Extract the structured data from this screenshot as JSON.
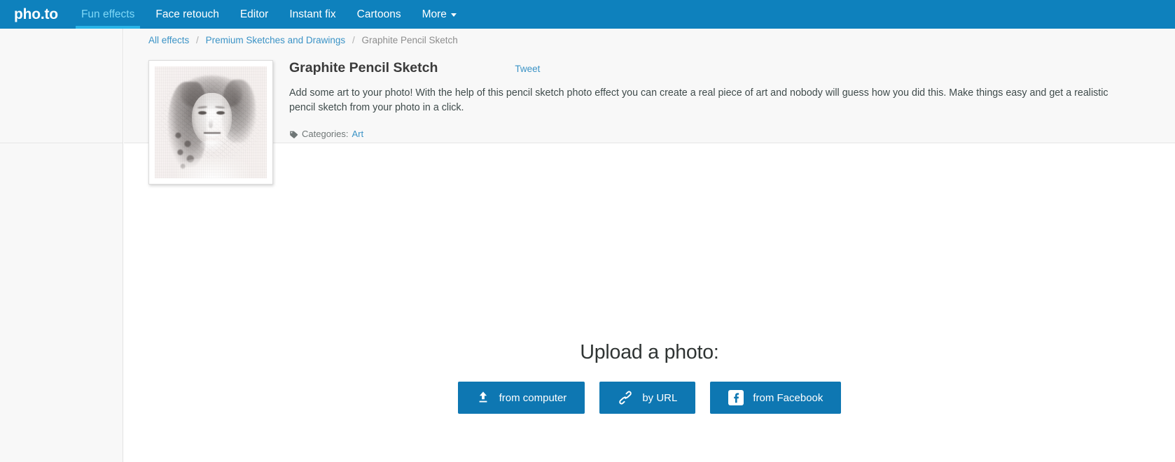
{
  "brand": {
    "name_left": "pho",
    "name_dot": ".",
    "name_right": "to",
    "full": "pho.to"
  },
  "nav": {
    "items": [
      {
        "label": "Fun effects",
        "active": true,
        "icon": ""
      },
      {
        "label": "Face retouch",
        "active": false,
        "icon": ""
      },
      {
        "label": "Editor",
        "active": false,
        "icon": ""
      },
      {
        "label": "Instant fix",
        "active": false,
        "icon": ""
      },
      {
        "label": "Cartoons",
        "active": false,
        "icon": ""
      },
      {
        "label": "More",
        "active": false,
        "icon": "chevron-down-icon"
      }
    ],
    "background_color": "#0e81bd",
    "active_color": "#7fd8f7",
    "active_underline_color": "#28b4e8"
  },
  "breadcrumb": {
    "all_effects": "All effects",
    "separator": "/",
    "category": "Premium Sketches and Drawings",
    "current": "Graphite Pencil Sketch"
  },
  "effect": {
    "title": "Graphite Pencil Sketch",
    "tweet_label": "Tweet",
    "description": "Add some art to your photo! With the help of this pencil sketch photo effect you can create a real piece of art and nobody will guess how you did this. Make things easy and get a realistic pencil sketch from your photo in a click.",
    "categories_label": "Categories:",
    "categories_icon": "tag-icon",
    "category_link": "Art",
    "thumbnail_alt": "graphite pencil sketch portrait preview"
  },
  "upload": {
    "title": "Upload a photo:",
    "buttons": [
      {
        "label": "from computer",
        "icon": "upload-arrow-icon"
      },
      {
        "label": "by URL",
        "icon": "link-chain-icon"
      },
      {
        "label": "from Facebook",
        "icon": "facebook-icon"
      }
    ],
    "button_color": "#0e77b2"
  },
  "colors": {
    "brand_blue": "#0e81bd",
    "button_blue": "#0e77b2",
    "link_blue": "#3b93c6",
    "panel_gray": "#f8f8f8",
    "text_dark": "#3b3b3b"
  }
}
